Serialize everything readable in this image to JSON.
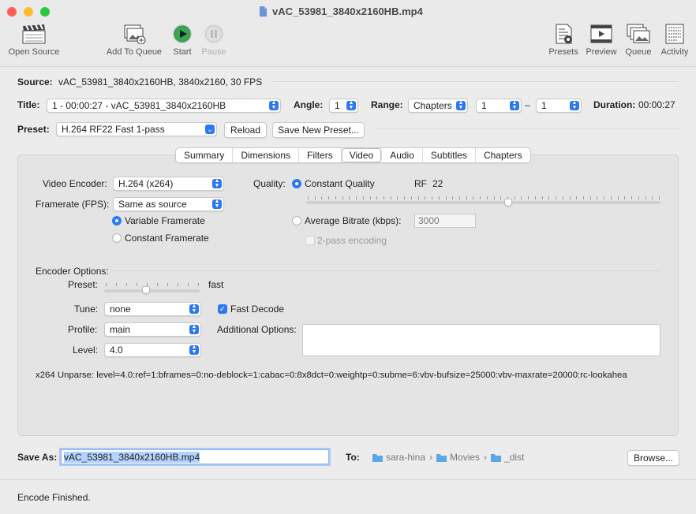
{
  "window": {
    "title": "vAC_53981_3840x2160HB.mp4"
  },
  "toolbar": {
    "open_source": "Open Source",
    "add_to_queue": "Add To Queue",
    "start": "Start",
    "pause": "Pause",
    "presets": "Presets",
    "preview": "Preview",
    "queue": "Queue",
    "activity": "Activity"
  },
  "source": {
    "label": "Source:",
    "value": "vAC_53981_3840x2160HB, 3840x2160, 30 FPS"
  },
  "title_row": {
    "title_label": "Title:",
    "title_value": "1 - 00:00:27 - vAC_53981_3840x2160HB",
    "angle_label": "Angle:",
    "angle_value": "1",
    "range_label": "Range:",
    "range_type": "Chapters",
    "range_start": "1",
    "range_dash": "–",
    "range_end": "1",
    "duration_label": "Duration:",
    "duration_value": "00:00:27"
  },
  "preset_row": {
    "preset_label": "Preset:",
    "preset_value": "H.264 RF22 Fast 1-pass",
    "reload": "Reload",
    "save_new": "Save New Preset..."
  },
  "tabs": [
    "Summary",
    "Dimensions",
    "Filters",
    "Video",
    "Audio",
    "Subtitles",
    "Chapters"
  ],
  "selected_tab": "Video",
  "video": {
    "encoder_label": "Video Encoder:",
    "encoder_value": "H.264 (x264)",
    "framerate_label": "Framerate (FPS):",
    "framerate_value": "Same as source",
    "variable_framerate": "Variable Framerate",
    "constant_framerate": "Constant Framerate",
    "quality_label": "Quality:",
    "constant_quality": "Constant Quality",
    "rf_label": "RF",
    "rf_value": "22",
    "quality_slider_fraction": 0.57,
    "average_bitrate": "Average Bitrate (kbps):",
    "bitrate_placeholder": "3000",
    "two_pass": "2-pass encoding",
    "encoder_options_label": "Encoder Options:",
    "preset_label": "Preset:",
    "preset_value": "fast",
    "preset_slider_fraction": 0.44,
    "tune_label": "Tune:",
    "tune_value": "none",
    "fast_decode": "Fast Decode",
    "profile_label": "Profile:",
    "profile_value": "main",
    "additional_options_label": "Additional Options:",
    "level_label": "Level:",
    "level_value": "4.0",
    "unparse": "x264 Unparse: level=4.0:ref=1:bframes=0:no-deblock=1:cabac=0:8x8dct=0:weightp=0:subme=6:vbv-bufsize=25000:vbv-maxrate=20000:rc-lookahea"
  },
  "save": {
    "label": "Save As:",
    "value": "vAC_53981_3840x2160HB.mp4",
    "to_label": "To:",
    "path": [
      "sara-hina",
      "Movies",
      "_dist"
    ],
    "browse": "Browse..."
  },
  "status": {
    "text": "Encode Finished."
  },
  "colors": {
    "accent": "#2c78f2",
    "start_green": "#34a853",
    "folder": "#5aa8e8"
  }
}
